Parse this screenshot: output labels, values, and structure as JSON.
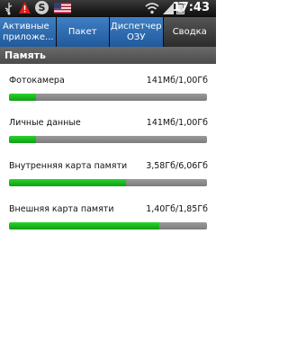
{
  "status_bar": {
    "time": "17:43",
    "icons": [
      "usb-icon",
      "warning-icon",
      "s-app-icon",
      "us-flag-icon",
      "wifi-icon",
      "signal-icon",
      "battery-icon"
    ],
    "s_badge": "S"
  },
  "tabs": [
    {
      "label": "Активные\nприложе...",
      "active": false
    },
    {
      "label": "Пакет",
      "active": false
    },
    {
      "label": "Диспетчер\nОЗУ",
      "active": false
    },
    {
      "label": "Сводка",
      "active": true
    }
  ],
  "section": {
    "title": "Память"
  },
  "memory": [
    {
      "label": "Фотокамера",
      "value": "141Мб/1,00Гб",
      "fill_percent": 13.8
    },
    {
      "label": "Личные данные",
      "value": "141Мб/1,00Гб",
      "fill_percent": 13.8
    },
    {
      "label": "Внутренняя карта памяти",
      "value": "3,58Гб/6,06Гб",
      "fill_percent": 59.1
    },
    {
      "label": "Внешняя карта памяти",
      "value": "1,40Гб/1,85Гб",
      "fill_percent": 75.7
    }
  ],
  "colors": {
    "tab_active_bg": "#2c2c2c",
    "tab_bg": "#205a9c",
    "bar_fill": "#17b81c",
    "bar_track": "#8a8a8a"
  }
}
